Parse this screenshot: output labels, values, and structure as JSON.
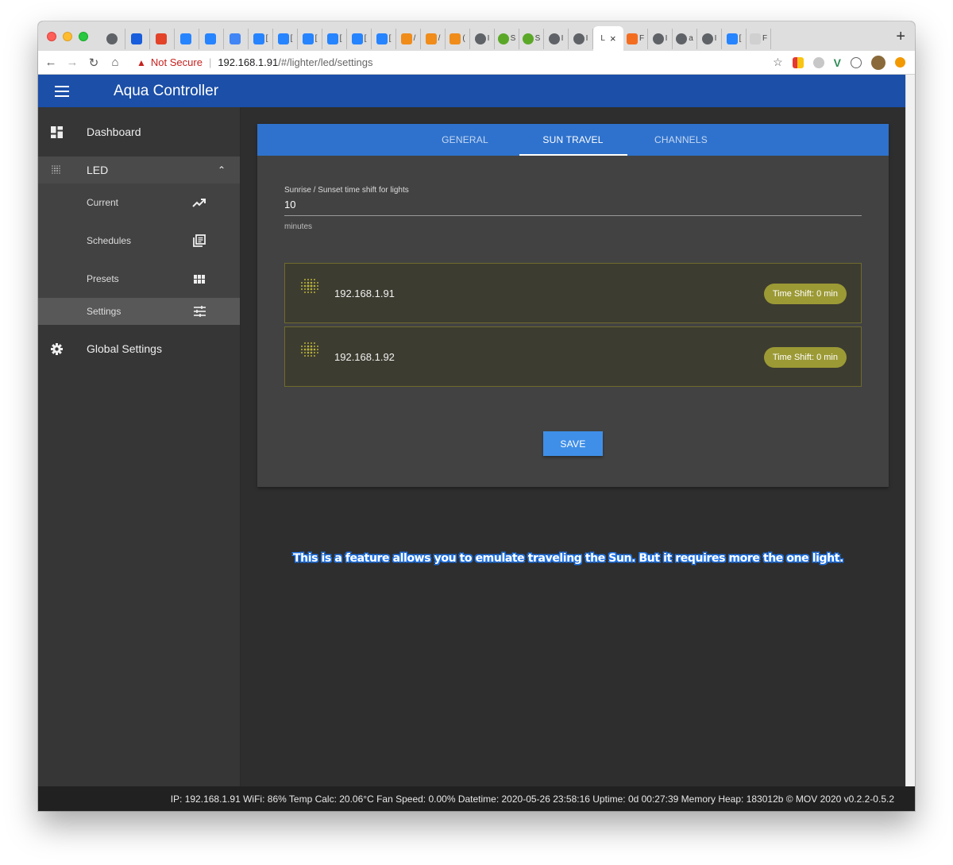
{
  "browser": {
    "tabs": [
      {
        "label": "",
        "icon": "globe-icon",
        "color": "#5f6368"
      },
      {
        "label": "",
        "icon": "bitwarden-icon",
        "color": "#175ddc"
      },
      {
        "label": "",
        "icon": "gitlab-icon",
        "color": "#e24329"
      },
      {
        "label": "",
        "icon": "confluence-icon",
        "color": "#2684ff"
      },
      {
        "label": "",
        "icon": "jira-icon",
        "color": "#2684ff"
      },
      {
        "label": "",
        "icon": "translate-icon",
        "color": "#4285f4"
      },
      {
        "label": "[",
        "icon": "jira-icon",
        "color": "#2684ff"
      },
      {
        "label": "[",
        "icon": "jira-icon",
        "color": "#2684ff"
      },
      {
        "label": "[",
        "icon": "jira-icon",
        "color": "#2684ff"
      },
      {
        "label": "[",
        "icon": "jira-icon",
        "color": "#2684ff"
      },
      {
        "label": "[",
        "icon": "jira-icon",
        "color": "#2684ff"
      },
      {
        "label": "[",
        "icon": "jira-icon",
        "color": "#2684ff"
      },
      {
        "label": "/",
        "icon": "package-icon",
        "color": "#f08c1a"
      },
      {
        "label": "/",
        "icon": "package-icon",
        "color": "#f08c1a"
      },
      {
        "label": "(",
        "icon": "package-icon",
        "color": "#f08c1a"
      },
      {
        "label": "I",
        "icon": "globe-icon",
        "color": "#5f6368"
      },
      {
        "label": "S",
        "icon": "green-circle-icon",
        "color": "#5ba829"
      },
      {
        "label": "S",
        "icon": "green-circle-icon",
        "color": "#5ba829"
      },
      {
        "label": "I",
        "icon": "globe-icon",
        "color": "#5f6368"
      },
      {
        "label": "I",
        "icon": "globe-icon",
        "color": "#5f6368"
      }
    ],
    "active_tab_label": "L",
    "tabs_after": [
      {
        "label": "F",
        "icon": "orange-square-icon",
        "color": "#f36d21"
      },
      {
        "label": "I",
        "icon": "globe-icon",
        "color": "#5f6368"
      },
      {
        "label": "a",
        "icon": "globe-icon",
        "color": "#5f6368"
      },
      {
        "label": "I",
        "icon": "globe-icon",
        "color": "#5f6368"
      },
      {
        "label": "[",
        "icon": "jira-icon",
        "color": "#2684ff"
      },
      {
        "label": "F",
        "icon": "sl-icon",
        "color": "#d0d0d0"
      }
    ],
    "not_secure": "Not Secure",
    "url_host": "192.168.1.91",
    "url_path": "/#/lighter/led/settings"
  },
  "app": {
    "title": "Aqua Controller",
    "header_color": "#1b4fa8"
  },
  "sidebar": {
    "dashboard": "Dashboard",
    "led": "LED",
    "sub_items": [
      {
        "label": "Current",
        "icon": "trending-up-icon"
      },
      {
        "label": "Schedules",
        "icon": "library-books-icon"
      },
      {
        "label": "Presets",
        "icon": "view-module-icon"
      },
      {
        "label": "Settings",
        "icon": "tune-icon"
      }
    ],
    "global_settings": "Global Settings"
  },
  "tabs": {
    "general": "GENERAL",
    "sun_travel": "SUN TRAVEL",
    "channels": "CHANNELS"
  },
  "form": {
    "label": "Sunrise / Sunset time shift for lights",
    "value": "10",
    "hint": "minutes"
  },
  "lights": [
    {
      "ip": "192.168.1.91",
      "chip": "Time Shift: 0 min"
    },
    {
      "ip": "192.168.1.92",
      "chip": "Time Shift: 0 min"
    }
  ],
  "save_label": "SAVE",
  "caption": "This is a feature allows you to emulate traveling the Sun. But it requires more the one light.",
  "footer": "IP: 192.168.1.91 WiFi: 86% Temp Calc: 20.06°C Fan Speed: 0.00% Datetime: 2020-05-26 23:58:16 Uptime: 0d 00:27:39 Memory Heap: 183012b © MOV 2020 v0.2.2-0.5.2"
}
